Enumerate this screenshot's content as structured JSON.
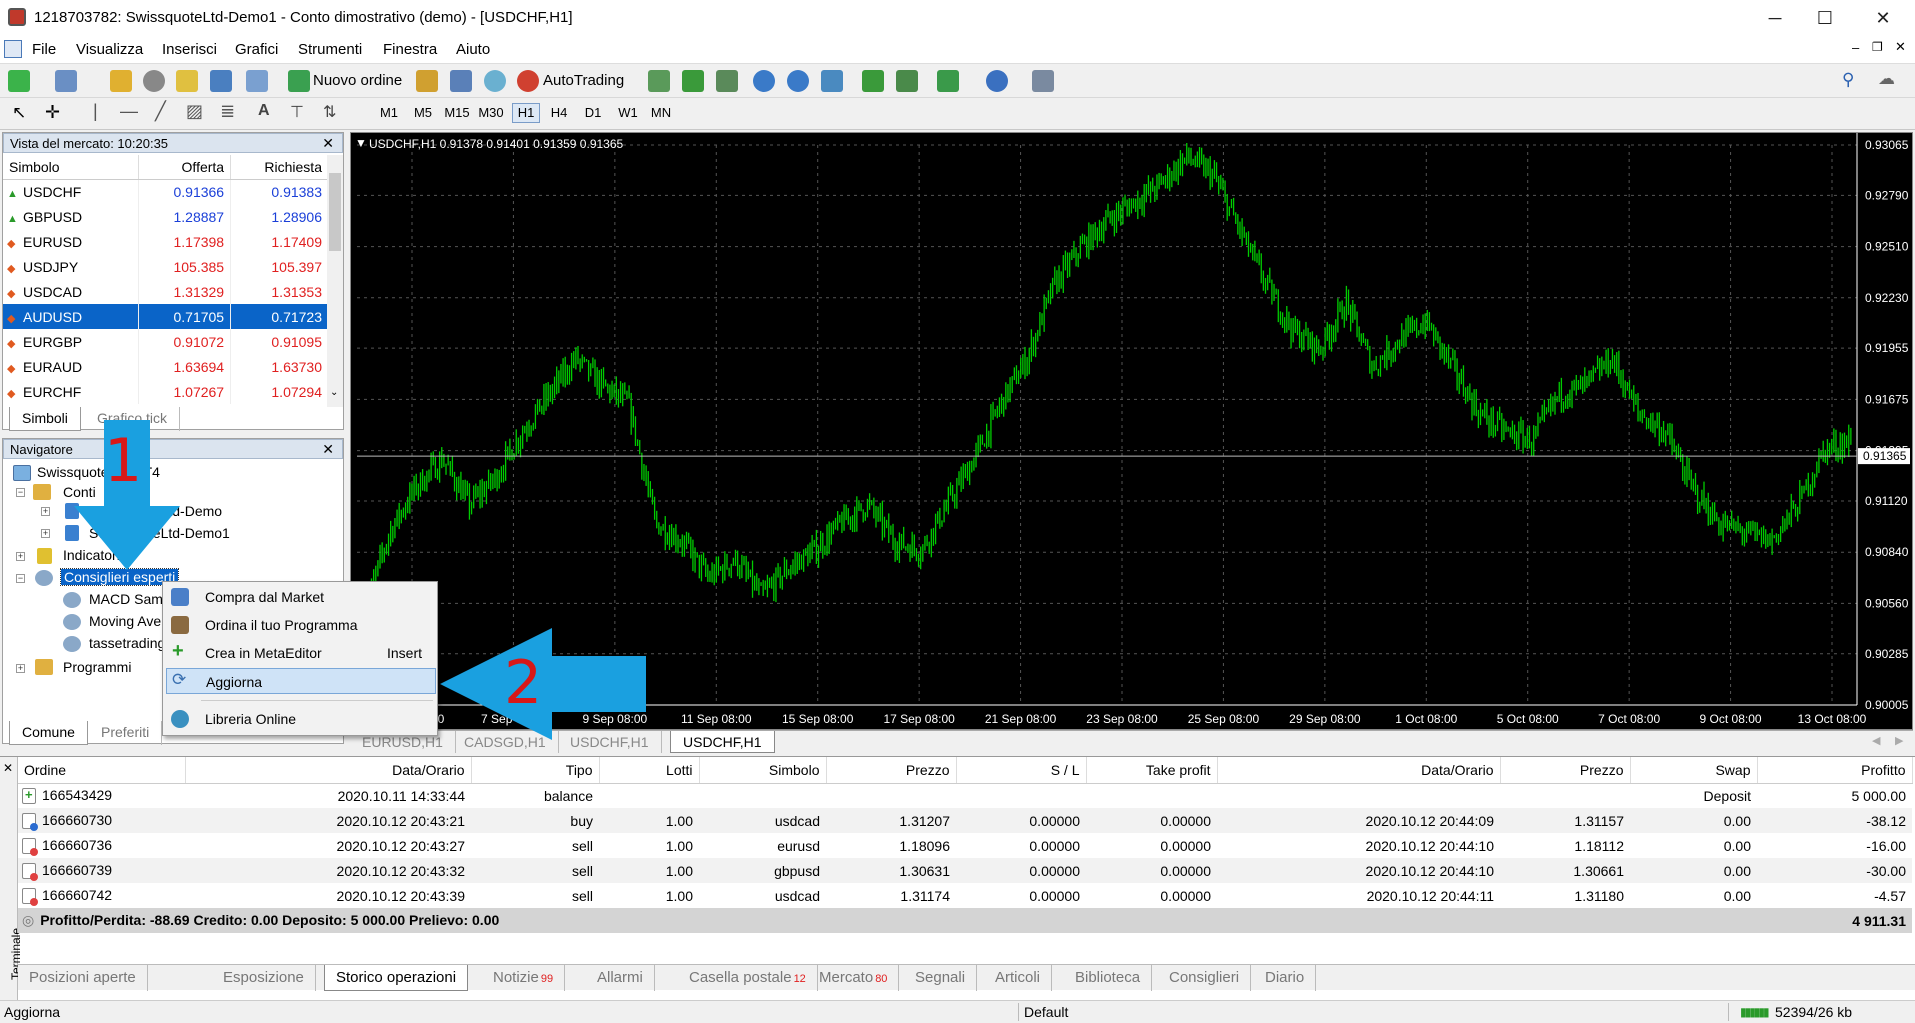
{
  "window": {
    "title": "1218703782: SwissquoteLtd-Demo1 - Conto dimostrativo (demo) - [USDCHF,H1]",
    "min_glyph": "─",
    "max_glyph": "☐",
    "close_glyph": "✕"
  },
  "menu": [
    "File",
    "Visualizza",
    "Inserisci",
    "Grafici",
    "Strumenti",
    "Finestra",
    "Aiuto"
  ],
  "toolbar": {
    "new_order": "Nuovo ordine",
    "autotrading": "AutoTrading",
    "timeframes": [
      "M1",
      "M5",
      "M15",
      "M30",
      "H1",
      "H4",
      "D1",
      "W1",
      "MN"
    ],
    "selected_timeframe": "H1"
  },
  "market_watch": {
    "title": "Vista del mercato: 10:20:35",
    "columns": [
      "Simbolo",
      "Offerta",
      "Richiesta"
    ],
    "rows": [
      {
        "symbol": "USDCHF",
        "bid": "0.91366",
        "ask": "0.91383",
        "dir": "up"
      },
      {
        "symbol": "GBPUSD",
        "bid": "1.28887",
        "ask": "1.28906",
        "dir": "up"
      },
      {
        "symbol": "EURUSD",
        "bid": "1.17398",
        "ask": "1.17409",
        "dir": "down"
      },
      {
        "symbol": "USDJPY",
        "bid": "105.385",
        "ask": "105.397",
        "dir": "down"
      },
      {
        "symbol": "USDCAD",
        "bid": "1.31329",
        "ask": "1.31353",
        "dir": "down"
      },
      {
        "symbol": "AUDUSD",
        "bid": "0.71705",
        "ask": "0.71723",
        "dir": "down",
        "selected": true
      },
      {
        "symbol": "EURGBP",
        "bid": "0.91072",
        "ask": "0.91095",
        "dir": "down"
      },
      {
        "symbol": "EURAUD",
        "bid": "1.63694",
        "ask": "1.63730",
        "dir": "down"
      },
      {
        "symbol": "EURCHF",
        "bid": "1.07267",
        "ask": "1.07294",
        "dir": "down"
      }
    ],
    "tabs": [
      "Simboli",
      "Grafico tick"
    ]
  },
  "navigator": {
    "title": "Navigatore",
    "root": "SwissquoteLtd MT4",
    "accounts": "Conti",
    "account_items": [
      "SwissquoteLtd-Demo",
      "SwissquoteLtd-Demo1"
    ],
    "indicators": "Indicatori",
    "experts": "Consiglieri esperti",
    "expert_items": [
      "MACD Sample",
      "Moving Average",
      "tassetrading"
    ],
    "scripts": "Programmi",
    "tabs": [
      "Comune",
      "Preferiti"
    ]
  },
  "context_menu": {
    "items": [
      {
        "label": "Compra dal Market",
        "shortcut": ""
      },
      {
        "label": "Ordina il tuo Programma",
        "shortcut": ""
      },
      {
        "label": "Crea in MetaEditor",
        "shortcut": "Insert"
      },
      {
        "label": "Aggiorna",
        "shortcut": ""
      },
      {
        "label": "Libreria Online",
        "shortcut": ""
      }
    ]
  },
  "annotations": {
    "step1": "1",
    "step2": "2",
    "arrow_color": "#1aa0e0"
  },
  "chart": {
    "header": "USDCHF,H1  0.91378 0.91401 0.91359 0.91365",
    "current_price": "0.91365",
    "tabs": [
      "EURUSD,H1",
      "CADSGD,H1",
      "USDCHF,H1",
      "USDCHF,H1"
    ],
    "candle_color": "#00cc00"
  },
  "chart_data": {
    "type": "line",
    "symbol": "USDCHF",
    "timeframe": "H1",
    "x_ticks": [
      "3 Sep 08:00",
      "7 Sep 08:00",
      "9 Sep 08:00",
      "11 Sep 08:00",
      "15 Sep 08:00",
      "17 Sep 08:00",
      "21 Sep 08:00",
      "23 Sep 08:00",
      "25 Sep 08:00",
      "29 Sep 08:00",
      "1 Oct 08:00",
      "5 Oct 08:00",
      "7 Oct 08:00",
      "9 Oct 08:00",
      "13 Oct 08:00"
    ],
    "y_ticks": [
      "0.93065",
      "0.92790",
      "0.92510",
      "0.92230",
      "0.91955",
      "0.91675",
      "0.91395",
      "0.91120",
      "0.90840",
      "0.90560",
      "0.90285",
      "0.90005"
    ],
    "ylim": [
      0.90005,
      0.93065
    ],
    "approx_path": [
      0.905,
      0.9095,
      0.912,
      0.9135,
      0.911,
      0.9125,
      0.915,
      0.917,
      0.919,
      0.9175,
      0.9165,
      0.91,
      0.909,
      0.907,
      0.908,
      0.906,
      0.9075,
      0.9085,
      0.91,
      0.911,
      0.909,
      0.9085,
      0.911,
      0.9135,
      0.9165,
      0.919,
      0.923,
      0.925,
      0.9265,
      0.9275,
      0.9285,
      0.93,
      0.929,
      0.926,
      0.923,
      0.9205,
      0.9195,
      0.922,
      0.9185,
      0.92,
      0.921,
      0.9185,
      0.916,
      0.915,
      0.9145,
      0.917,
      0.9175,
      0.919,
      0.916,
      0.915,
      0.912,
      0.91,
      0.9095,
      0.909,
      0.911,
      0.914,
      0.9145
    ]
  },
  "terminal": {
    "side_label": "Terminale",
    "columns": [
      "Ordine",
      "Data/Orario",
      "Tipo",
      "Lotti",
      "Simbolo",
      "Prezzo",
      "S / L",
      "Take profit",
      "Data/Orario",
      "Prezzo",
      "Swap",
      "Profitto"
    ],
    "rows": [
      {
        "icon": "balance",
        "order": "166543429",
        "open_time": "2020.10.11 14:33:44",
        "type": "balance",
        "lots": "",
        "symbol": "",
        "price": "",
        "sl": "",
        "tp": "",
        "close_time": "",
        "close_price": "",
        "swap": "Deposit",
        "profit": "5 000.00"
      },
      {
        "icon": "buy",
        "order": "166660730",
        "open_time": "2020.10.12 20:43:21",
        "type": "buy",
        "lots": "1.00",
        "symbol": "usdcad",
        "price": "1.31207",
        "sl": "0.00000",
        "tp": "0.00000",
        "close_time": "2020.10.12 20:44:09",
        "close_price": "1.31157",
        "swap": "0.00",
        "profit": "-38.12"
      },
      {
        "icon": "sell",
        "order": "166660736",
        "open_time": "2020.10.12 20:43:27",
        "type": "sell",
        "lots": "1.00",
        "symbol": "eurusd",
        "price": "1.18096",
        "sl": "0.00000",
        "tp": "0.00000",
        "close_time": "2020.10.12 20:44:10",
        "close_price": "1.18112",
        "swap": "0.00",
        "profit": "-16.00"
      },
      {
        "icon": "sell",
        "order": "166660739",
        "open_time": "2020.10.12 20:43:32",
        "type": "sell",
        "lots": "1.00",
        "symbol": "gbpusd",
        "price": "1.30631",
        "sl": "0.00000",
        "tp": "0.00000",
        "close_time": "2020.10.12 20:44:10",
        "close_price": "1.30661",
        "swap": "0.00",
        "profit": "-30.00"
      },
      {
        "icon": "sell",
        "order": "166660742",
        "open_time": "2020.10.12 20:43:39",
        "type": "sell",
        "lots": "1.00",
        "symbol": "usdcad",
        "price": "1.31174",
        "sl": "0.00000",
        "tp": "0.00000",
        "close_time": "2020.10.12 20:44:11",
        "close_price": "1.31180",
        "swap": "0.00",
        "profit": "-4.57"
      }
    ],
    "summary": "Profitto/Perdita: -88.69  Credito: 0.00  Deposito: 5 000.00  Prelievo: 0.00",
    "summary_total": "4 911.31",
    "tabs": [
      {
        "label": "Posizioni aperte",
        "badge": ""
      },
      {
        "label": "Esposizione",
        "badge": ""
      },
      {
        "label": "Storico operazioni",
        "badge": "",
        "active": true
      },
      {
        "label": "Notizie",
        "badge": "99"
      },
      {
        "label": "Allarmi",
        "badge": ""
      },
      {
        "label": "Casella postale",
        "badge": "12"
      },
      {
        "label": "Mercato",
        "badge": "80"
      },
      {
        "label": "Segnali",
        "badge": ""
      },
      {
        "label": "Articoli",
        "badge": ""
      },
      {
        "label": "Biblioteca",
        "badge": ""
      },
      {
        "label": "Consiglieri",
        "badge": ""
      },
      {
        "label": "Diario",
        "badge": ""
      }
    ]
  },
  "status_bar": {
    "left": "Aggiorna",
    "profile": "Default",
    "traffic": "52394/26 kb"
  }
}
